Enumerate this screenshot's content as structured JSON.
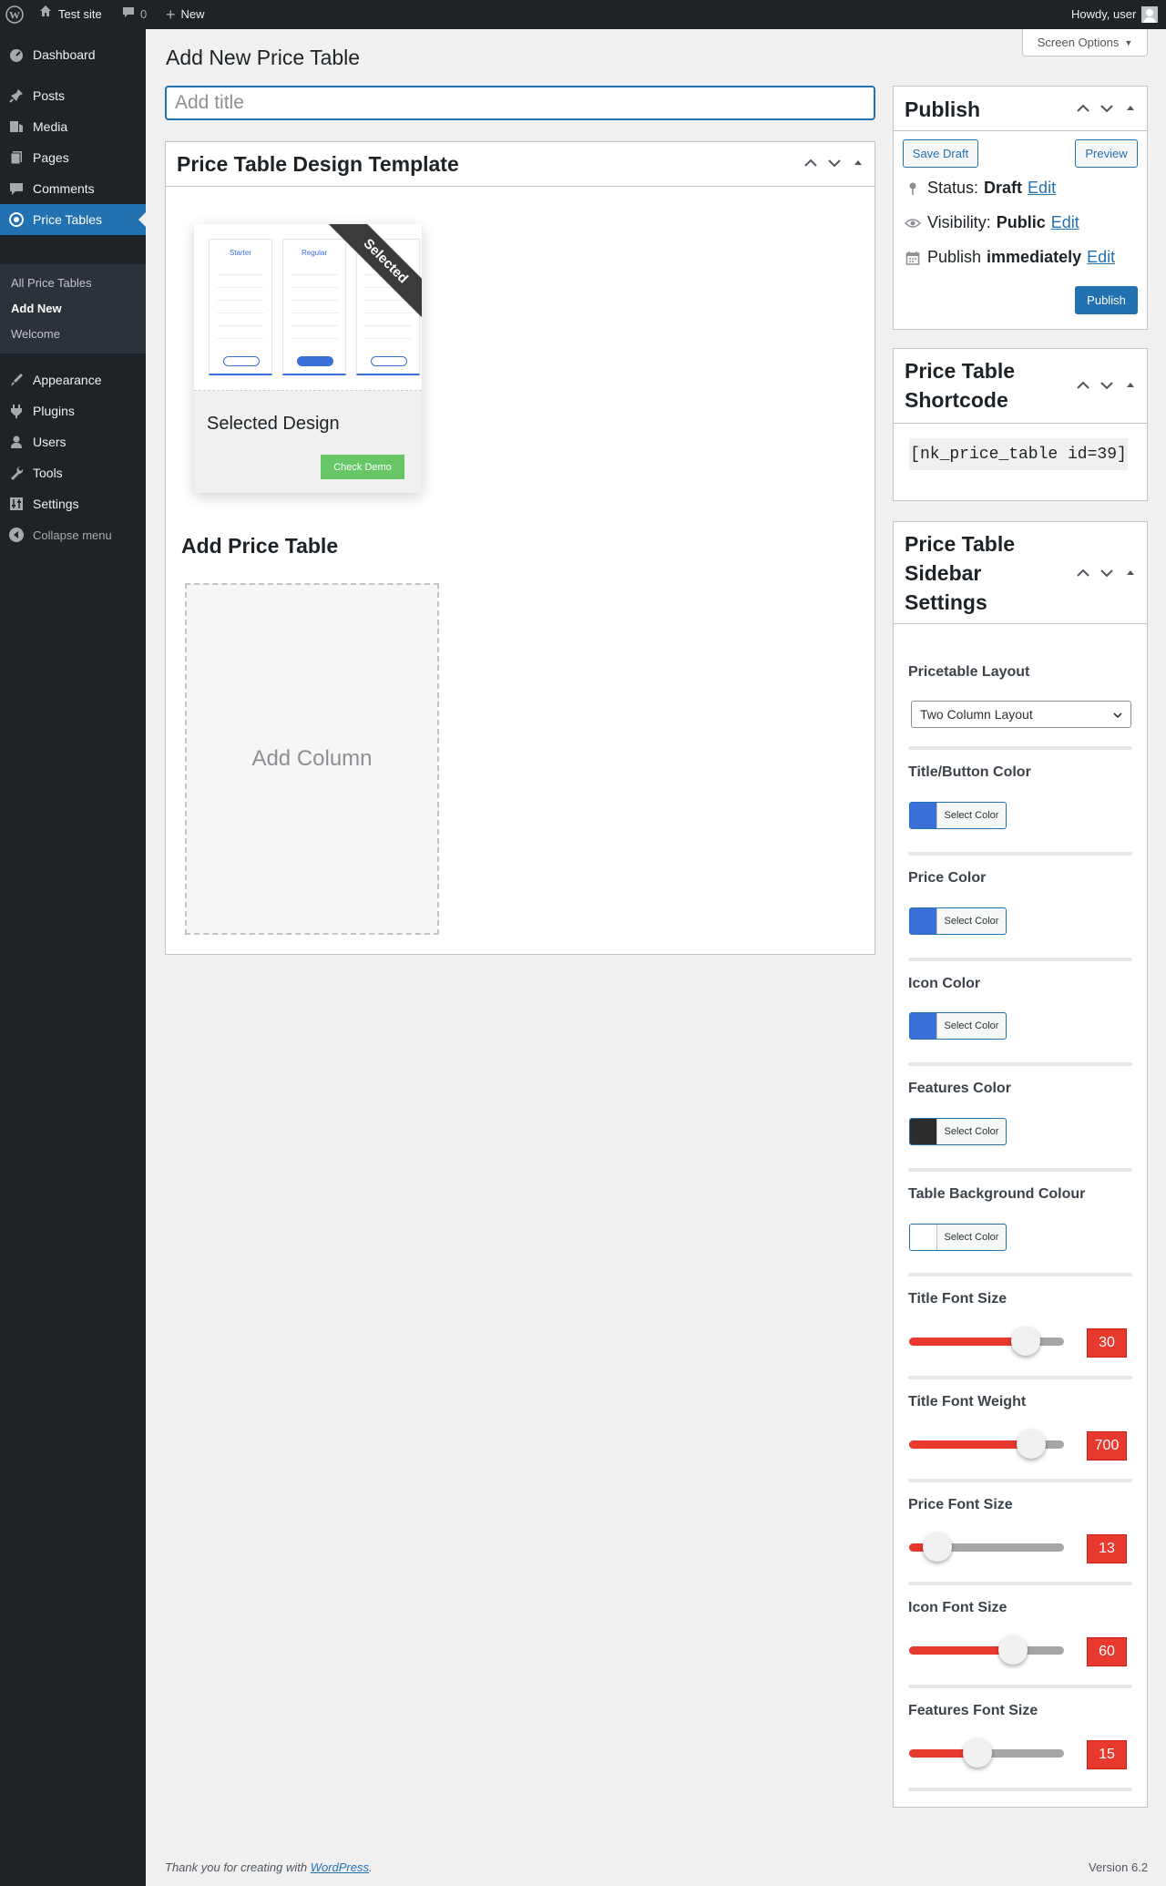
{
  "admin_bar": {
    "site_name": "Test site",
    "comment_count": "0",
    "new_label": "New",
    "greeting": "Howdy, user"
  },
  "sidebar": {
    "items": [
      {
        "label": "Dashboard",
        "icon": "dashboard-icon"
      },
      {
        "label": "Posts",
        "icon": "pushpin-icon"
      },
      {
        "label": "Media",
        "icon": "media-icon"
      },
      {
        "label": "Pages",
        "icon": "pages-icon"
      },
      {
        "label": "Comments",
        "icon": "comments-icon"
      },
      {
        "label": "Price Tables",
        "icon": "price-tables-icon"
      },
      {
        "label": "Appearance",
        "icon": "appearance-icon"
      },
      {
        "label": "Plugins",
        "icon": "plugins-icon"
      },
      {
        "label": "Users",
        "icon": "users-icon"
      },
      {
        "label": "Tools",
        "icon": "tools-icon"
      },
      {
        "label": "Settings",
        "icon": "settings-icon"
      },
      {
        "label": "Collapse menu",
        "icon": "collapse-icon"
      }
    ],
    "submenu": [
      "All Price Tables",
      "Add New",
      "Welcome"
    ],
    "current_color": "#2271b1"
  },
  "screen_options": "Screen Options",
  "page_title": "Add New Price Table",
  "title_placeholder": "Add title",
  "design_template": {
    "heading": "Price Table Design Template",
    "preview_columns": [
      "Starter",
      "Regular",
      ""
    ],
    "ribbon": "Selected",
    "name": "Selected Design",
    "demo_button": "Check Demo"
  },
  "add_table": {
    "heading": "Add Price Table",
    "add_column": "Add Column"
  },
  "publish": {
    "heading": "Publish",
    "save_draft": "Save Draft",
    "preview": "Preview",
    "status_label": "Status:",
    "status_value": "Draft",
    "visibility_label": "Visibility:",
    "visibility_value": "Public",
    "publish_label": "Publish",
    "publish_value": "immediately",
    "edit": "Edit",
    "publish_button": "Publish"
  },
  "shortcode_box": {
    "heading_line1": "Price Table",
    "heading_line2": "Shortcode",
    "code": "[nk_price_table id=39]"
  },
  "sidebar_settings": {
    "heading_line1": "Price Table",
    "heading_line2": "Sidebar",
    "heading_line3": "Settings",
    "layout_label": "Pricetable Layout",
    "layout_value": "Two Column Layout",
    "select_color_label": "Select Color",
    "colors": [
      {
        "label": "Title/Button Color",
        "swatch": "#3a6fd8"
      },
      {
        "label": "Price Color",
        "swatch": "#3a6fd8"
      },
      {
        "label": "Icon Color",
        "swatch": "#3a6fd8"
      },
      {
        "label": "Features Color",
        "swatch": "#2c2c2c"
      },
      {
        "label": "Table Background Colour",
        "swatch": "#ffffff"
      }
    ],
    "sliders": [
      {
        "label": "Title Font Size",
        "value": "30",
        "fraction": 0.75
      },
      {
        "label": "Title Font Weight",
        "value": "700",
        "fraction": 0.79
      },
      {
        "label": "Price Font Size",
        "value": "13",
        "fraction": 0.18
      },
      {
        "label": "Icon Font Size",
        "value": "60",
        "fraction": 0.67
      },
      {
        "label": "Features Font Size",
        "value": "15",
        "fraction": 0.44
      }
    ]
  },
  "footer": {
    "thanks_prefix": "Thank you for creating with",
    "link": "WordPress",
    "suffix": ".",
    "version": "Version 6.2"
  }
}
